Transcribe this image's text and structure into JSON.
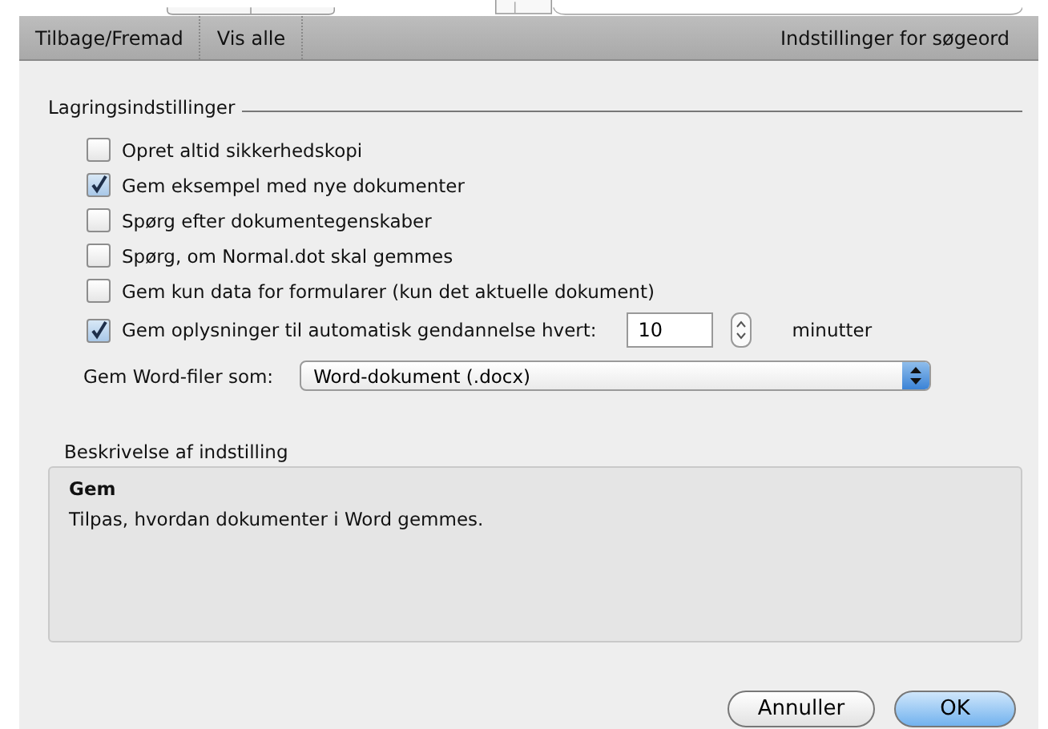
{
  "toolbar": {
    "items": [
      {
        "label": "Tilbage/Fremad",
        "kind": "backforward"
      },
      {
        "label": "Vis alle",
        "kind": "showall"
      }
    ],
    "right_label": "Indstillinger for søgeord"
  },
  "section_title": "Lagringsindstillinger",
  "options": [
    {
      "label": "Opret altid sikkerhedskopi",
      "checked": false
    },
    {
      "label": "Gem eksempel med nye dokumenter",
      "checked": true
    },
    {
      "label": "Spørg efter dokumentegenskaber",
      "checked": false
    },
    {
      "label": "Spørg, om Normal.dot skal gemmes",
      "checked": false
    },
    {
      "label": "Gem kun data for formularer (kun det aktuelle dokument)",
      "checked": false
    },
    {
      "label": "Gem oplysninger til automatisk gendannelse hvert:",
      "checked": true,
      "value": "10",
      "unit": "minutter"
    }
  ],
  "save_as": {
    "label": "Gem Word-filer som:",
    "value": "Word-dokument (.docx)"
  },
  "description": {
    "title": "Beskrivelse af indstilling",
    "heading": "Gem",
    "text": "Tilpas, hvordan dokumenter i Word gemmes."
  },
  "buttons": [
    {
      "label": "Annuller",
      "kind": "cancel"
    },
    {
      "label": "OK",
      "kind": "default"
    }
  ]
}
